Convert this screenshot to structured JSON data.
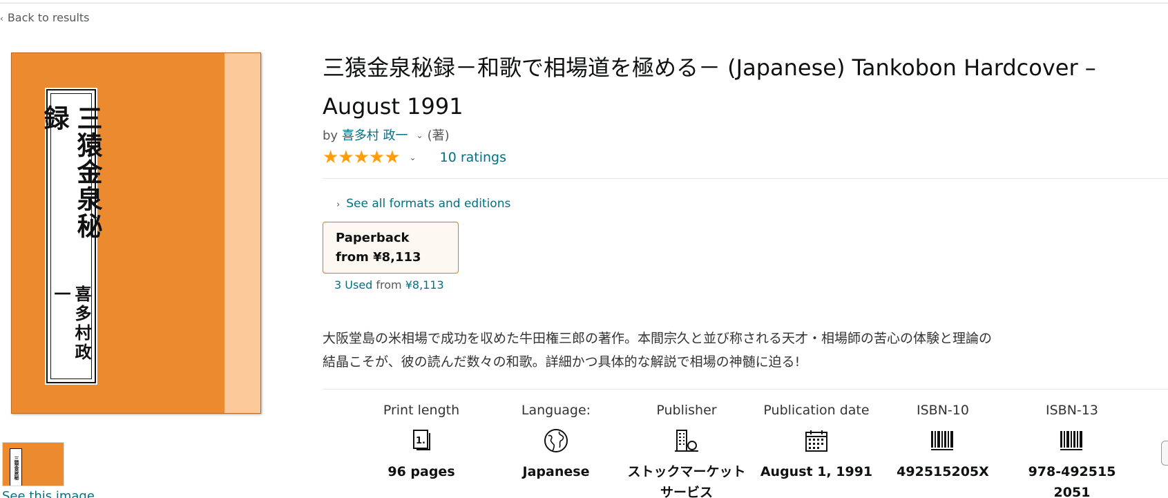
{
  "nav": {
    "back_chevron": "‹",
    "back_label": "Back to results"
  },
  "cover": {
    "title_vertical": "三猿金泉秘録",
    "author_vertical": "喜多村政一",
    "thumb_label": "三猿金泉秘",
    "see_image_label": "See this image"
  },
  "product": {
    "title": "三猿金泉秘録－和歌で相場道を極める－ (Japanese) Tankobon Hardcover – August 1991",
    "by_prefix": "by",
    "author": "喜多村 政一",
    "author_caret": "⌄",
    "author_role": "(著)",
    "stars": "★★★★★",
    "rating_caret": "⌄",
    "ratings_count": "10 ratings"
  },
  "formats": {
    "see_all_chevron": "›",
    "see_all_label": "See all formats and editions",
    "selected_format": {
      "name": "Paperback",
      "price": "from ¥8,113"
    },
    "used_link": "3 Used",
    "used_from": " from ",
    "used_price": "¥8,113"
  },
  "description": "大阪堂島の米相場で成功を収めた牛田権三郎の著作。本間宗久と並び称される天才・相場師の苦心の体験と理論の結晶こそが、彼の読んだ数々の和歌。詳細かつ具体的な解説で相場の神髄に迫る!",
  "details": [
    {
      "label": "Print length",
      "icon": "book-pages-icon",
      "value": "96 pages"
    },
    {
      "label": "Language:",
      "icon": "globe-icon",
      "value": "Japanese"
    },
    {
      "label": "Publisher",
      "icon": "building-icon",
      "value": "ストックマーケットサービス"
    },
    {
      "label": "Publication date",
      "icon": "calendar-icon",
      "value": "August 1, 1991"
    },
    {
      "label": "ISBN-10",
      "icon": "barcode-icon",
      "value": "492515205X"
    },
    {
      "label": "ISBN-13",
      "icon": "barcode-icon",
      "value": "978-4925152051"
    }
  ],
  "colors": {
    "link": "#007185",
    "star": "#ff9d0a",
    "format_border": "#e77600",
    "cover_orange": "#ec8a2f"
  }
}
